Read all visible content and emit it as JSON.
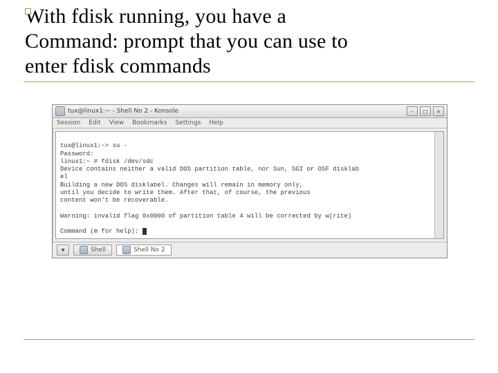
{
  "title": {
    "line1_pre": "With ",
    "line1_fdisk": "fdisk",
    "line1_post": " running, you have a",
    "line2_pre": "Command: prompt that you can use to",
    "line3_pre": "enter ",
    "line3_fdisk": "fdisk",
    "line3_post": " commands"
  },
  "window": {
    "title": "tux@linux1:~ - Shell No 2 - Konsole",
    "buttons": {
      "min": "–",
      "max": "▢",
      "close": "×"
    }
  },
  "menu": {
    "session": "Session",
    "edit": "Edit",
    "view": "View",
    "bookmarks": "Bookmarks",
    "settings": "Settings",
    "help": "Help"
  },
  "terminal": {
    "l1": "tux@linux1:~> su -",
    "l2": "Password:",
    "l3": "linux1:~ # fdisk /dev/sdc",
    "l4": "Device contains neither a valid DOS partition table, nor Sun, SGI or OSF disklab",
    "l5": "el",
    "l6": "Building a new DOS disklabel. Changes will remain in memory only,",
    "l7": "until you decide to write them. After that, of course, the previous",
    "l8": "content won't be recoverable.",
    "l10": "Warning: invalid flag 0x0000 of partition table 4 will be corrected by w(rite)",
    "l12": "Command (m for help): "
  },
  "tabs": {
    "newtab_glyph": "▾",
    "shell1": "Shell",
    "shell2": "Shell No 2"
  }
}
